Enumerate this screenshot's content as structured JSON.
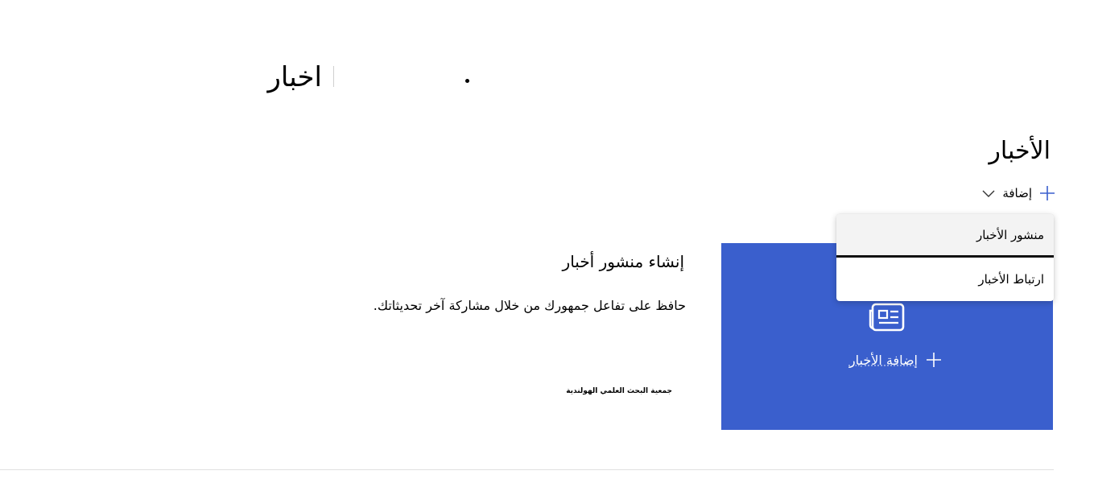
{
  "page": {
    "title": "اخبار"
  },
  "news_section": {
    "title": "الأخبار",
    "toolbar": {
      "add_label": "إضافة"
    },
    "empty_state": {
      "title": "إنشاء منشور أخبار",
      "description": "حافظ على تفاعل جمهورك من خلال مشاركة آخر تحديثاتك.",
      "org_name": "جمعية البحث العلمي الهولندية"
    },
    "card": {
      "icon": "news-icon",
      "add_label": "إضافة الأخبار"
    },
    "menu": {
      "items": [
        {
          "label": "منشور الأخبار"
        },
        {
          "label": "ارتباط الأخبار"
        }
      ]
    }
  },
  "colors": {
    "accent": "#3a5fcd",
    "card_text": "#ffffff",
    "menu_hover": "#f3f3f3"
  }
}
